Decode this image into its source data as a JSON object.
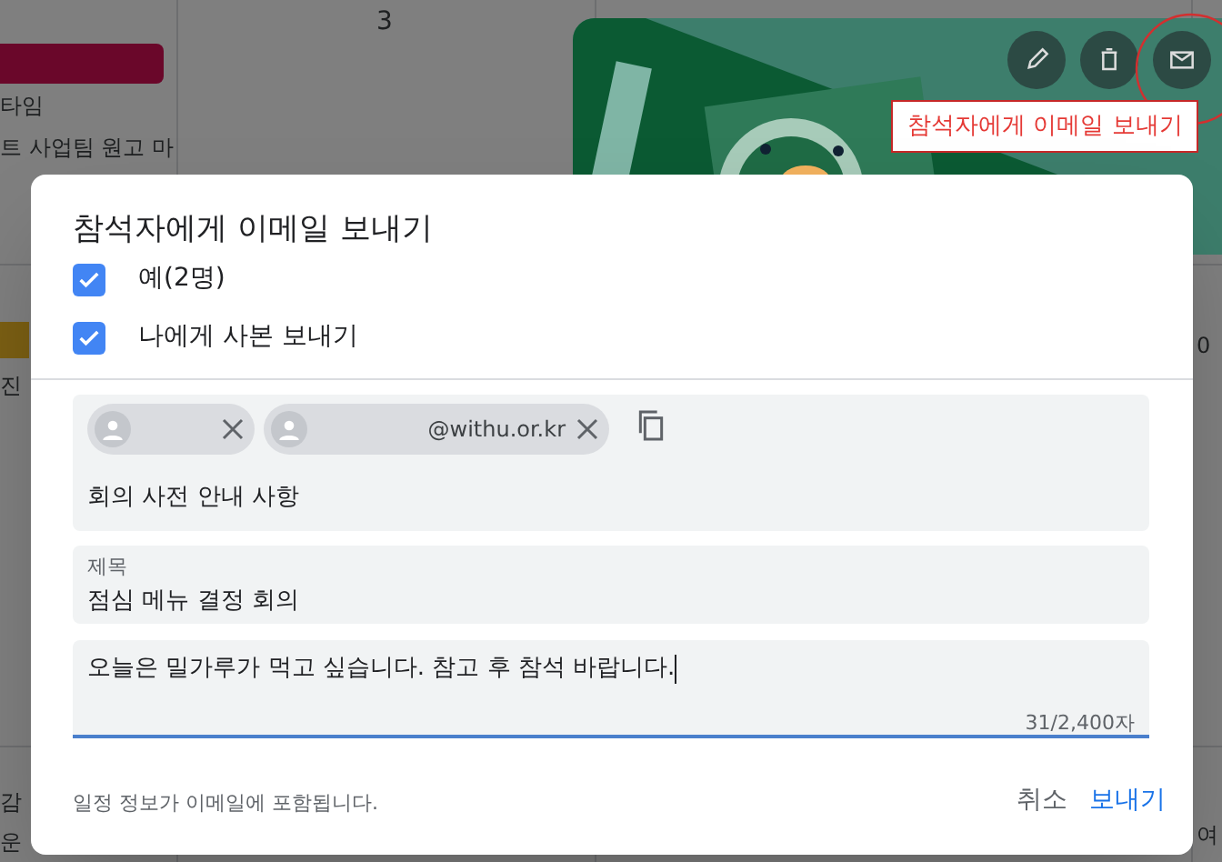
{
  "calendar": {
    "day_numbers": [
      "3"
    ],
    "left_texts": [
      "타임",
      "트 사업팀 원고 마",
      "진"
    ],
    "bottom_texts": [
      "감",
      "운"
    ],
    "right_texts": [
      "0",
      "여"
    ]
  },
  "event_card": {
    "tooltip": "참석자에게 이메일 보내기"
  },
  "dialog": {
    "title": "참석자에게 이메일 보내기",
    "checkboxes": [
      {
        "label": "예(2명)",
        "checked": true
      },
      {
        "label": "나에게 사본 보내기",
        "checked": true
      }
    ],
    "recipient_chips": [
      {
        "kind": "hidden"
      },
      {
        "kind": "address",
        "address": "@withu.or.kr"
      }
    ],
    "note": "회의 사전 안내 사항",
    "subject": {
      "label": "제목",
      "value": "점심 메뉴 결정 회의"
    },
    "message": {
      "value": "오늘은 밀가루가 먹고 싶습니다. 참고 후 참석 바랍니다.",
      "counter": "31/2,400자"
    },
    "footer": {
      "info": "일정 정보가 이메일에 포함됩니다.",
      "cancel": "취소",
      "send": "보내기"
    }
  }
}
